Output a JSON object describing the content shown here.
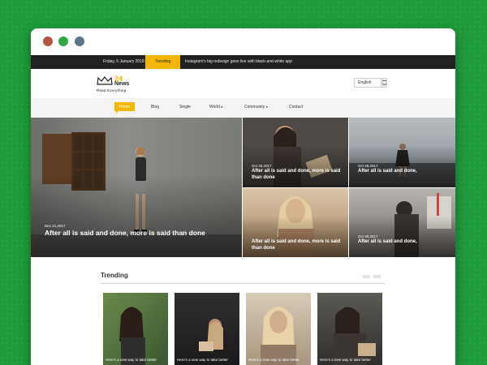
{
  "browser": {
    "buttons": [
      "close",
      "maximize",
      "minimize"
    ]
  },
  "topbar": {
    "date": "Friday, 5 January 2018",
    "tag": "Trending",
    "headline": "Instagram's big redesign goes live with black-and-white app"
  },
  "logo": {
    "number": "24",
    "word": "News",
    "tagline": "Read Everything"
  },
  "language": {
    "value": "English"
  },
  "nav": [
    {
      "label": "Home"
    },
    {
      "label": "Blog"
    },
    {
      "label": "Single"
    },
    {
      "label": "World"
    },
    {
      "label": "Community"
    },
    {
      "label": "Contact"
    }
  ],
  "hero": {
    "main": {
      "date": "Dec 21,2017",
      "title": "After all is said and done, more is said than done"
    },
    "side": [
      {
        "date": "Oct 28,2017",
        "title": "After all is said and done, more is said than done"
      },
      {
        "date": "Oct 28,2017",
        "title": "After all is said and done,"
      },
      {
        "date": "",
        "title": "After all is said and done, more is said than done"
      },
      {
        "date": "Oct 28,2017",
        "title": "After all is said and done,"
      }
    ]
  },
  "trending": {
    "heading": "Trending",
    "cards": [
      {
        "caption": "Here's a new way to take better"
      },
      {
        "caption": "Here's a new way to take better"
      },
      {
        "caption": "Here's a new way to take better"
      },
      {
        "caption": "Here's a new way to take better"
      }
    ]
  },
  "colors": {
    "accent": "#f2b705",
    "dark": "#222222",
    "background": "#1e9a3a"
  }
}
